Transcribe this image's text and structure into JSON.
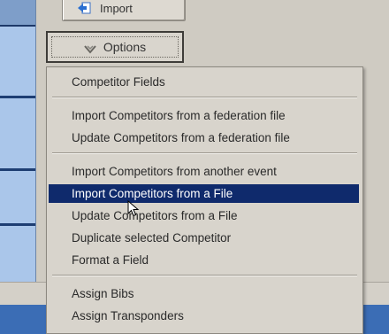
{
  "toolbar": {
    "import_label": "Import",
    "options_label": "Options"
  },
  "menu": {
    "groups": [
      [
        "Competitor Fields"
      ],
      [
        "Import Competitors from a federation file",
        "Update Competitors from a federation file"
      ],
      [
        "Import Competitors from another event",
        "Import Competitors from a File",
        "Update Competitors from a File",
        "Duplicate selected Competitor",
        "Format a Field"
      ],
      [
        "Assign Bibs",
        "Assign Transponders"
      ]
    ],
    "selected_item": "Import Competitors from a File"
  },
  "colors": {
    "menu_highlight": "#0f2a6c",
    "left_panel": "#aac6ea",
    "bottom_band": "#3b6db5"
  },
  "icons": {
    "import": "import-arrow-icon",
    "options": "chevron-down-icon",
    "cursor": "mouse-pointer-icon"
  }
}
